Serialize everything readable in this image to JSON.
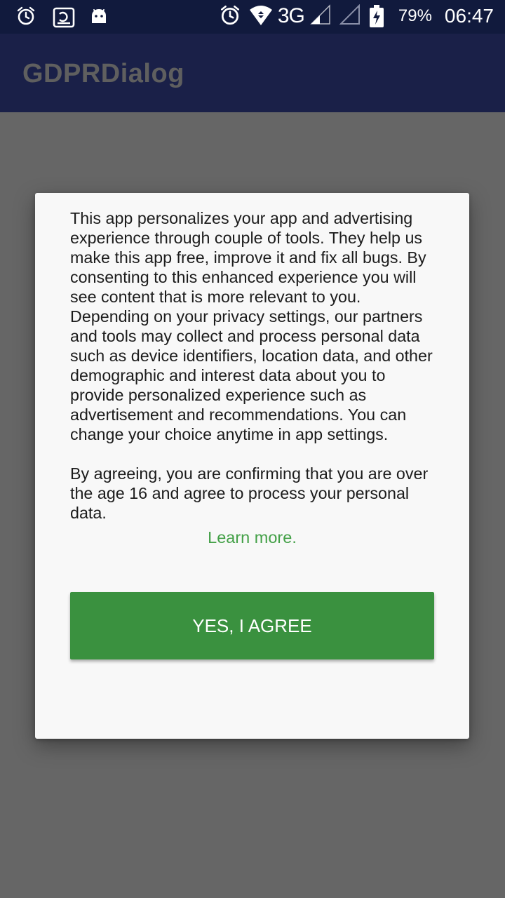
{
  "status_bar": {
    "left_icons": [
      "alarm-clock-icon",
      "storage-icon",
      "android-icon"
    ],
    "network": "3G",
    "battery_percent": "79%",
    "time": "06:47"
  },
  "app_bar": {
    "title": "GDPRDialog"
  },
  "dialog": {
    "paragraphs": [
      "This app personalizes your app and advertising experience through couple of tools. They help us make this app free, improve it and fix all bugs. By consenting to this enhanced experience you will see content that is more relevant to you. Depending on your privacy settings, our partners and tools may collect and process personal data such as device identifiers, location data, and other demographic and interest data about you to provide personalized experience such as advertisement and recommendations. You can change your choice anytime in app settings.",
      "By agreeing, you are confirming that you are over the age 16 and agree to process your personal data."
    ],
    "learn_more": "Learn more.",
    "agree_button": "YES, I AGREE"
  },
  "colors": {
    "status_bar": "#111a3d",
    "app_bar": "#1a2048",
    "scrim": "#666666",
    "accent_green": "#3a913f",
    "link_green": "#43a047"
  }
}
